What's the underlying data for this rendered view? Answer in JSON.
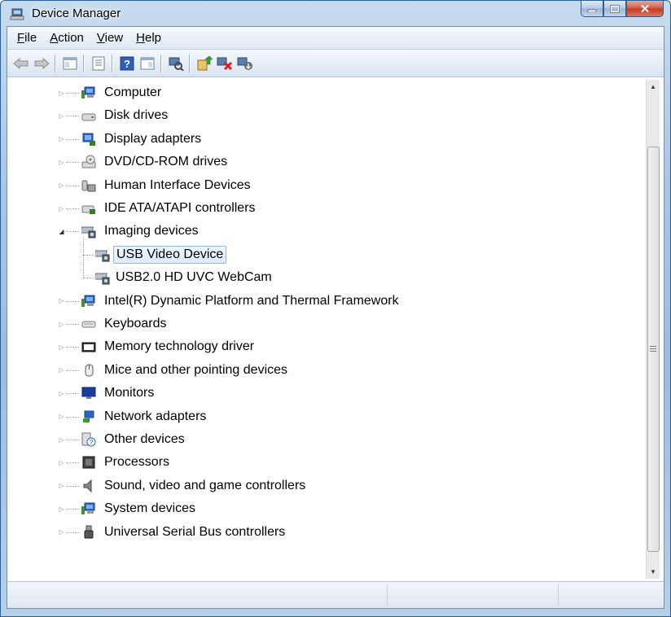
{
  "window": {
    "title": "Device Manager",
    "minimize": "—",
    "maximize": "▢",
    "close": "✕"
  },
  "menu": [
    {
      "accel": "F",
      "rest": "ile"
    },
    {
      "accel": "A",
      "rest": "ction"
    },
    {
      "accel": "V",
      "rest": "iew"
    },
    {
      "accel": "H",
      "rest": "elp"
    }
  ],
  "toolbar": [
    "back-icon",
    "forward-icon",
    "show-hide-console-tree-icon",
    "properties-icon",
    "help-icon",
    "console-tree-icon",
    "scan-hardware-icon",
    "update-driver-icon",
    "uninstall-icon",
    "disable-device-icon"
  ],
  "tree": [
    {
      "label": "Computer",
      "icon": "computer-icon",
      "level": 0,
      "state": "collapsed"
    },
    {
      "label": "Disk drives",
      "icon": "disk-drive-icon",
      "level": 0,
      "state": "collapsed"
    },
    {
      "label": "Display adapters",
      "icon": "display-adapter-icon",
      "level": 0,
      "state": "collapsed"
    },
    {
      "label": "DVD/CD-ROM drives",
      "icon": "dvd-drive-icon",
      "level": 0,
      "state": "collapsed"
    },
    {
      "label": "Human Interface Devices",
      "icon": "hid-icon",
      "level": 0,
      "state": "collapsed"
    },
    {
      "label": "IDE ATA/ATAPI controllers",
      "icon": "ide-controller-icon",
      "level": 0,
      "state": "collapsed"
    },
    {
      "label": "Imaging devices",
      "icon": "camera-icon",
      "level": 0,
      "state": "expanded"
    },
    {
      "label": "USB Video Device",
      "icon": "camera-icon",
      "level": 1,
      "state": "leaf",
      "selected": true
    },
    {
      "label": "USB2.0 HD UVC WebCam",
      "icon": "camera-icon",
      "level": 1,
      "state": "leaf"
    },
    {
      "label": "Intel(R) Dynamic Platform and Thermal Framework",
      "icon": "computer-icon",
      "level": 0,
      "state": "collapsed"
    },
    {
      "label": "Keyboards",
      "icon": "keyboard-icon",
      "level": 0,
      "state": "collapsed"
    },
    {
      "label": "Memory technology driver",
      "icon": "memory-icon",
      "level": 0,
      "state": "collapsed"
    },
    {
      "label": "Mice and other pointing devices",
      "icon": "mouse-icon",
      "level": 0,
      "state": "collapsed"
    },
    {
      "label": "Monitors",
      "icon": "monitor-icon",
      "level": 0,
      "state": "collapsed"
    },
    {
      "label": "Network adapters",
      "icon": "network-adapter-icon",
      "level": 0,
      "state": "collapsed"
    },
    {
      "label": "Other devices",
      "icon": "unknown-device-icon",
      "level": 0,
      "state": "collapsed"
    },
    {
      "label": "Processors",
      "icon": "processor-icon",
      "level": 0,
      "state": "collapsed"
    },
    {
      "label": "Sound, video and game controllers",
      "icon": "speaker-icon",
      "level": 0,
      "state": "collapsed"
    },
    {
      "label": "System devices",
      "icon": "computer-icon",
      "level": 0,
      "state": "collapsed"
    },
    {
      "label": "Universal Serial Bus controllers",
      "icon": "usb-icon",
      "level": 0,
      "state": "collapsed"
    }
  ],
  "colors": {
    "selection_border": "#8fb7e3",
    "selection_fill": "#dbeafc",
    "frame": "#a9c6e6"
  }
}
